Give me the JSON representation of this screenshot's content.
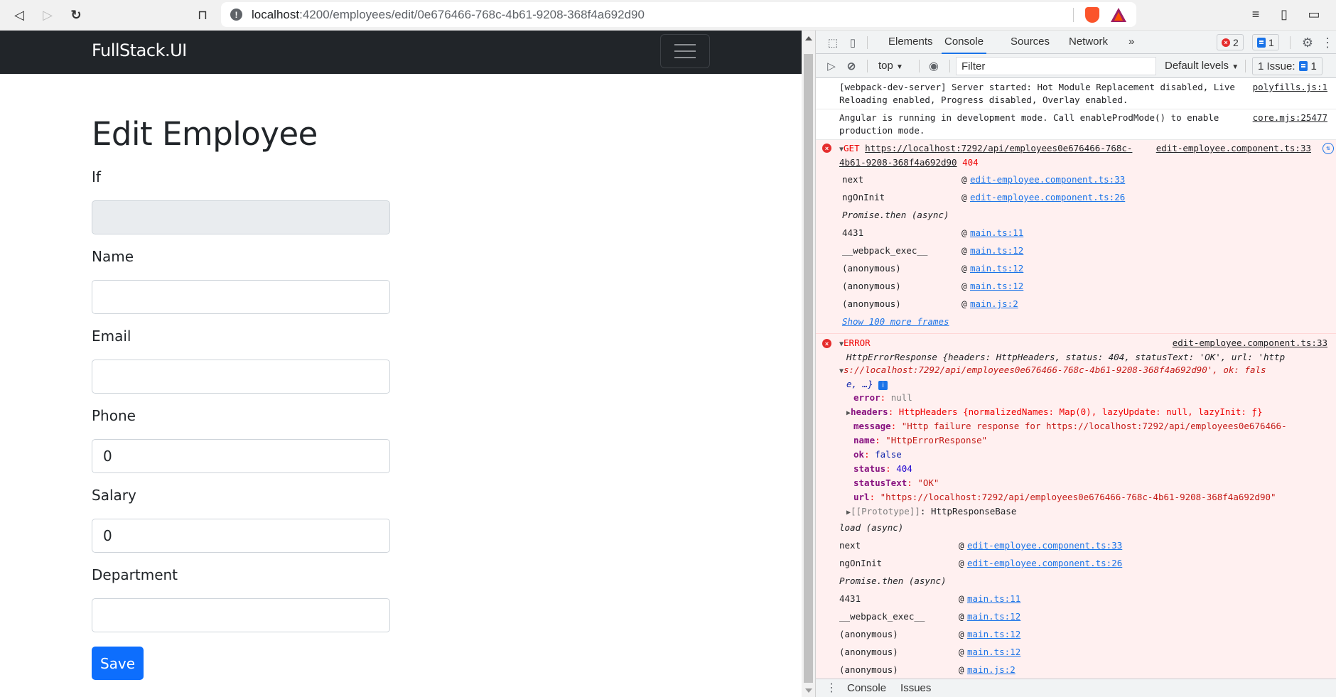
{
  "browser": {
    "url_host": "localhost",
    "url_rest": ":4200/employees/edit/0e676466-768c-4b61-9208-368f4a692d90",
    "icons": [
      "back-icon",
      "forward-icon",
      "reload-icon",
      "bookmark-icon",
      "site-info-icon",
      "brave-shields-icon",
      "brave-rewards-icon",
      "playlist-icon",
      "sidebar-icon",
      "wallet-icon"
    ]
  },
  "app": {
    "brand": "FullStack.UI",
    "page_title": "Edit Employee",
    "fields": [
      {
        "label": "If",
        "value": "",
        "disabled": true
      },
      {
        "label": "Name",
        "value": ""
      },
      {
        "label": "Email",
        "value": ""
      },
      {
        "label": "Phone",
        "value": "0"
      },
      {
        "label": "Salary",
        "value": "0"
      },
      {
        "label": "Department",
        "value": ""
      }
    ],
    "save_label": "Save"
  },
  "devtools": {
    "tabs": [
      "Elements",
      "Console",
      "Sources",
      "Network"
    ],
    "active_tab": "Console",
    "more_tabs": "»",
    "error_count": "2",
    "message_count": "1",
    "context": "top",
    "filter_placeholder": "Filter",
    "levels": "Default levels",
    "issues_label": "1 Issue:",
    "issues_count": "1",
    "drawer_tabs": [
      "Console",
      "Issues"
    ],
    "messages": {
      "webpack": {
        "text": "[webpack-dev-server] Server started: Hot Module Replacement disabled, Live Reloading enabled, Progress disabled, Overlay enabled.",
        "source": "polyfills.js:1"
      },
      "angular": {
        "text": "Angular is running in development mode. Call enableProdMode() to enable production mode.",
        "source": "core.mjs:25477"
      },
      "get_error": {
        "method": "GET",
        "url": "https://localhost:7292/api/employees0e676466-768c-4b61-9208-368f4a692d90",
        "status": "404",
        "source": "edit-employee.component.ts:33",
        "stack": [
          {
            "fn": "next",
            "loc": "edit-employee.component.ts:33"
          },
          {
            "fn": "ngOnInit",
            "loc": "edit-employee.component.ts:26"
          },
          {
            "async": "Promise.then (async)"
          },
          {
            "fn": "4431",
            "loc": "main.ts:11"
          },
          {
            "fn": "__webpack_exec__",
            "loc": "main.ts:12"
          },
          {
            "fn": "(anonymous)",
            "loc": "main.ts:12"
          },
          {
            "fn": "(anonymous)",
            "loc": "main.ts:12"
          },
          {
            "fn": "(anonymous)",
            "loc": "main.js:2"
          }
        ],
        "show_more": "Show 100 more frames"
      },
      "error_obj": {
        "label": "ERROR",
        "source": "edit-employee.component.ts:33",
        "summary_1": "HttpErrorResponse {headers: HttpHeaders, status: 404, statusText: 'OK', url: 'http",
        "summary_2": "s://localhost:7292/api/employees0e676466-768c-4b61-9208-368f4a692d90', ok: fals",
        "summary_3": "e, …}",
        "props": {
          "error": "null",
          "headers": "HttpHeaders {normalizedNames: Map(0), lazyUpdate: null, lazyInit: ƒ}",
          "message": "\"Http failure response for https://localhost:7292/api/employees0e676466-",
          "name": "\"HttpErrorResponse\"",
          "ok": "false",
          "status": "404",
          "statusText": "\"OK\"",
          "url": "\"https://localhost:7292/api/employees0e676466-768c-4b61-9208-368f4a692d90\"",
          "prototype": "HttpResponseBase"
        },
        "stack": [
          {
            "async": "load (async)"
          },
          {
            "fn": "next",
            "loc": "edit-employee.component.ts:33"
          },
          {
            "fn": "ngOnInit",
            "loc": "edit-employee.component.ts:26"
          },
          {
            "async": "Promise.then (async)"
          },
          {
            "fn": "4431",
            "loc": "main.ts:11"
          },
          {
            "fn": "__webpack_exec__",
            "loc": "main.ts:12"
          },
          {
            "fn": "(anonymous)",
            "loc": "main.ts:12"
          },
          {
            "fn": "(anonymous)",
            "loc": "main.ts:12"
          },
          {
            "fn": "(anonymous)",
            "loc": "main.js:2"
          }
        ]
      }
    }
  }
}
